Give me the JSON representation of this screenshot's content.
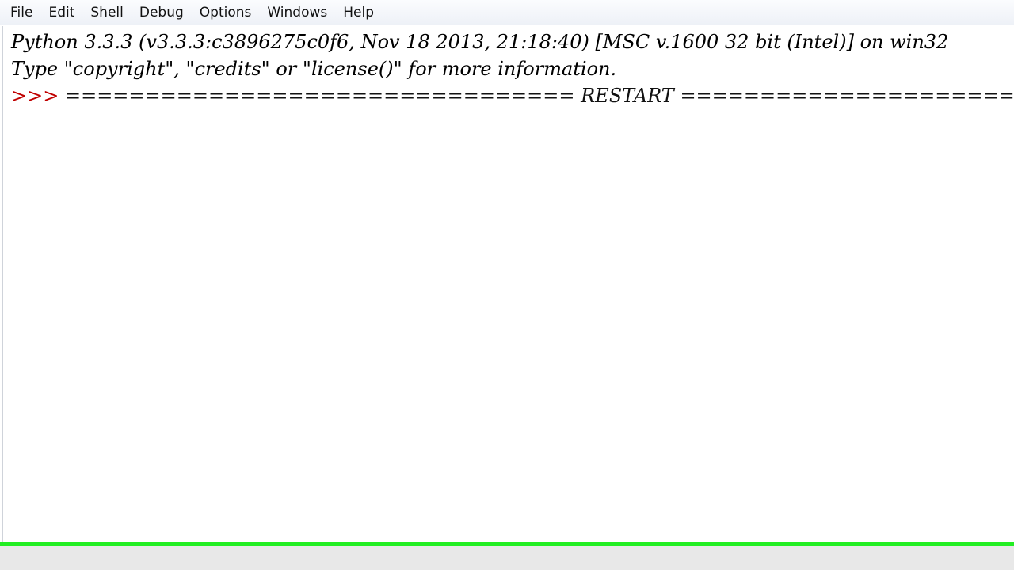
{
  "menu": {
    "items": [
      {
        "label": "File"
      },
      {
        "label": "Edit"
      },
      {
        "label": "Shell"
      },
      {
        "label": "Debug"
      },
      {
        "label": "Options"
      },
      {
        "label": "Windows"
      },
      {
        "label": "Help"
      }
    ]
  },
  "shell": {
    "banner_line1": "Python 3.3.3 (v3.3.3:c3896275c0f6, Nov 18 2013, 21:18:40) [MSC v.1600 32 bit (Intel)] on win32",
    "banner_line2": "Type \"copyright\", \"credits\" or \"license()\" for more information.",
    "prompt": ">>> ",
    "restart_line": "================================ RESTART ================================"
  },
  "colors": {
    "prompt": "#c00000",
    "status_separator": "#22ee22"
  }
}
